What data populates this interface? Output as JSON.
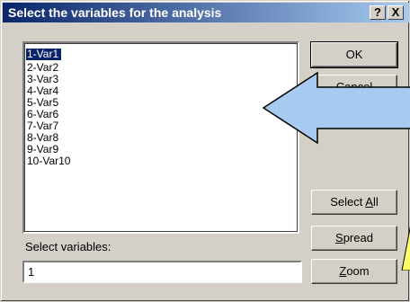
{
  "dialog": {
    "title": "Select the variables for the analysis",
    "help_label": "?",
    "close_label": "X"
  },
  "variables": {
    "items": [
      {
        "label": "1-Var1",
        "selected": true
      },
      {
        "label": "2-Var2",
        "selected": false
      },
      {
        "label": "3-Var3",
        "selected": false
      },
      {
        "label": "4-Var4",
        "selected": false
      },
      {
        "label": "5-Var5",
        "selected": false
      },
      {
        "label": "6-Var6",
        "selected": false
      },
      {
        "label": "7-Var7",
        "selected": false
      },
      {
        "label": "8-Var8",
        "selected": false
      },
      {
        "label": "9-Var9",
        "selected": false
      },
      {
        "label": "10-Var10",
        "selected": false
      }
    ]
  },
  "buttons": {
    "ok": "OK",
    "cancel": "Cancel",
    "select_all_pre": "Select ",
    "select_all_u": "A",
    "select_all_post": "ll",
    "spread_u": "S",
    "spread_post": "pread",
    "zoom_u": "Z",
    "zoom_post": "oom"
  },
  "select_field": {
    "label": "Select variables:",
    "value": "1"
  },
  "overlay": {
    "arrow_color": "#a6caf0",
    "arrow_stroke": "#000000",
    "callout_color": "#ffff66"
  }
}
